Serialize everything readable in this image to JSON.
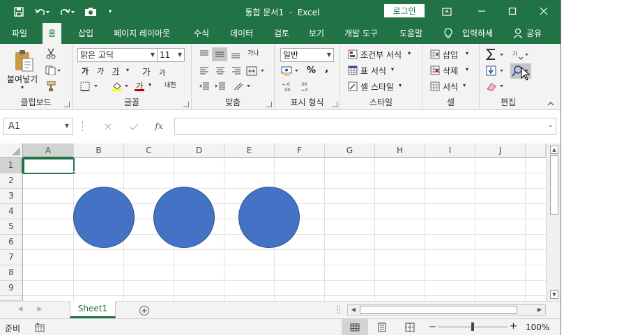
{
  "title": {
    "text": "통합 문서1  -  Excel",
    "login": "로그인"
  },
  "tabs": [
    "파일",
    "홈",
    "삽입",
    "페이지 레이아웃",
    "수식",
    "데이터",
    "검토",
    "보기",
    "개발 도구",
    "도움말"
  ],
  "tell_me": "입력하세",
  "share": "공유",
  "ribbon": {
    "clipboard": {
      "paste": "붙여넣기",
      "label": "클립보드"
    },
    "font": {
      "name": "맑은 고딕",
      "size": "11",
      "bold": "가",
      "italic": "가",
      "underline": "가",
      "grow": "가",
      "shrink": "가",
      "color_a": "가",
      "phonetic": "내천",
      "label": "글꼴"
    },
    "align": {
      "wrap": "가나",
      "label": "맞춤"
    },
    "number": {
      "format": "일반",
      "percent": "%",
      "comma": ",",
      "inc": ".0\n.00",
      "label": "표시 형식",
      "inc_label": "←.0",
      "dec_label": ".00→.0"
    },
    "styles": {
      "cond": "조건부 서식",
      "table": "표 서식",
      "cell": "셀 스타일",
      "label": "스타일"
    },
    "cells": {
      "insert": "삽입",
      "delete": "삭제",
      "format": "서식",
      "label": "셀"
    },
    "editing": {
      "label": "편집"
    }
  },
  "formula_bar": {
    "name_box": "A1",
    "fx": "fx",
    "value": ""
  },
  "columns": [
    "A",
    "B",
    "C",
    "D",
    "E",
    "F",
    "G",
    "H",
    "I",
    "J"
  ],
  "rows": [
    "1",
    "2",
    "3",
    "4",
    "5",
    "6",
    "7",
    "8",
    "9"
  ],
  "sheet_tab": "Sheet1",
  "status": {
    "ready": "준비",
    "zoom": "100%",
    "minus": "−",
    "plus": "+"
  },
  "colors": {
    "accent": "#217346",
    "shape_fill": "#4472c4"
  }
}
